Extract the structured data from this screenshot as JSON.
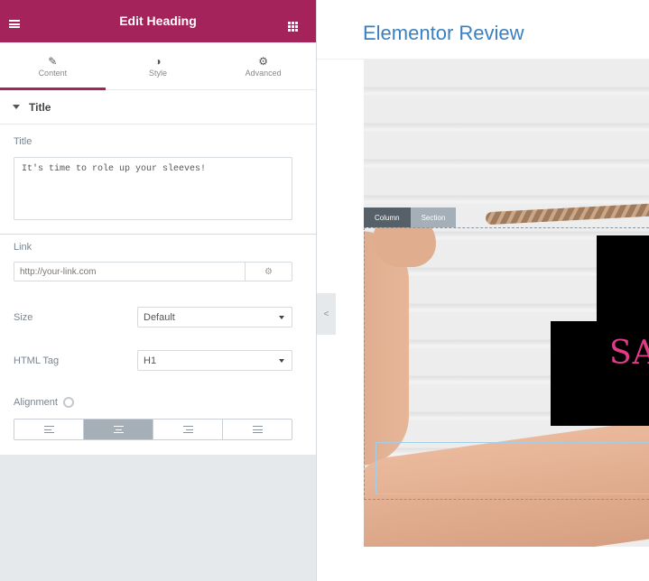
{
  "panel": {
    "header_title": "Edit Heading",
    "tabs": [
      {
        "label": "Content",
        "icon": "pencil-icon"
      },
      {
        "label": "Style",
        "icon": "contrast-icon"
      },
      {
        "label": "Advanced",
        "icon": "gear-icon"
      }
    ],
    "section_title": "Title",
    "title_label": "Title",
    "title_value": "It's time to role up your sleeves!",
    "link_label": "Link",
    "link_placeholder": "http://your-link.com",
    "size_label": "Size",
    "size_value": "Default",
    "html_tag_label": "HTML Tag",
    "html_tag_value": "H1",
    "alignment_label": "Alignment",
    "alignment_selected": "center",
    "accent_color": "#a4235b"
  },
  "collapse_glyph": "<",
  "preview": {
    "page_title": "Elementor Review",
    "column_tab": "Column",
    "section_tab": "Section",
    "sign_text": "SA",
    "title_color": "#3a7fc1"
  }
}
